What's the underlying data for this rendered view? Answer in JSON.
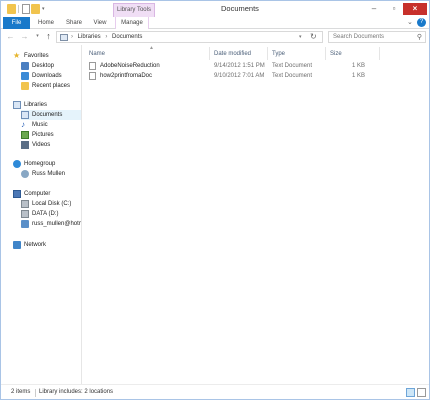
{
  "window": {
    "title": "Documents"
  },
  "ribbon": {
    "context_group": "Library Tools",
    "tabs": [
      "File",
      "Home",
      "Share",
      "View",
      "Manage"
    ]
  },
  "address": {
    "path": [
      "Libraries",
      "Documents"
    ],
    "search_placeholder": "Search Documents"
  },
  "nav": {
    "favorites": {
      "label": "Favorites",
      "items": [
        "Desktop",
        "Downloads",
        "Recent places"
      ]
    },
    "libraries": {
      "label": "Libraries",
      "items": [
        "Documents",
        "Music",
        "Pictures",
        "Videos"
      ]
    },
    "homegroup": {
      "label": "Homegroup",
      "items": [
        "Russ Mullen"
      ]
    },
    "computer": {
      "label": "Computer",
      "items": [
        "Local Disk (C:)",
        "DATA (D:)",
        "russ_mullen@hotm"
      ]
    },
    "network": {
      "label": "Network"
    },
    "selected": "Documents"
  },
  "columns": {
    "name": "Name",
    "date": "Date modified",
    "type": "Type",
    "size": "Size"
  },
  "files": [
    {
      "name": "AdobeNoiseReduction",
      "date": "9/14/2012 1:51 PM",
      "type": "Text Document",
      "size": "1 KB"
    },
    {
      "name": "how2printfromaDoc",
      "date": "9/10/2012 7:01 AM",
      "type": "Text Document",
      "size": "1 KB"
    }
  ],
  "status": {
    "count": "2 items",
    "library": "Library includes: 2 locations"
  },
  "colors": {
    "accent": "#1979ca",
    "close": "#c7302b",
    "library_tools": "#f0def5"
  }
}
